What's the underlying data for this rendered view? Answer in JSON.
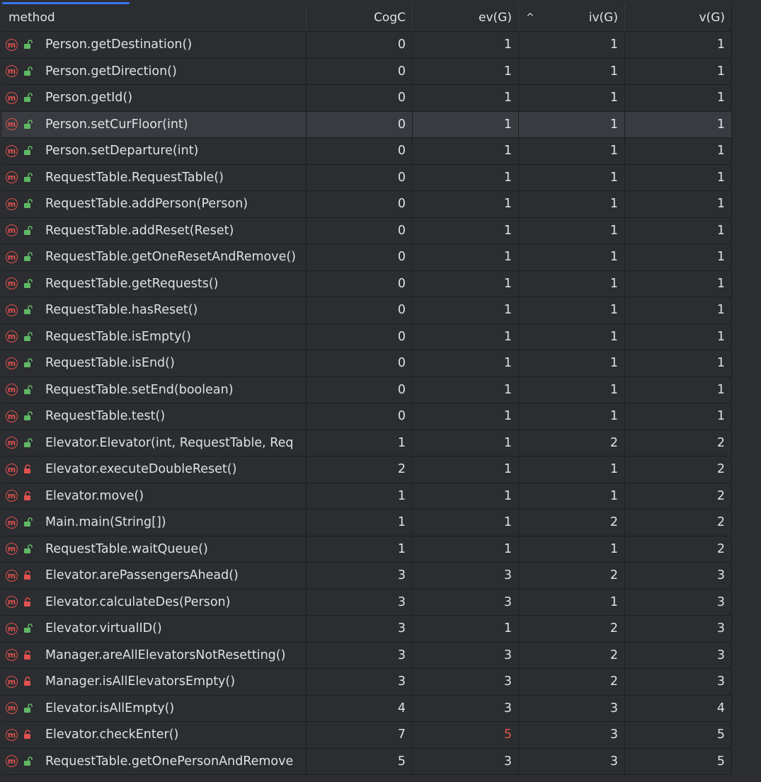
{
  "header": {
    "method": "method",
    "cogc": "CogC",
    "evg": "ev(G)",
    "ivg": "iv(G)",
    "sort_indicator": "^",
    "vg": "v(G)"
  },
  "colors": {
    "method_icon": "#e0524f",
    "public_lock": "#5fb865",
    "private_lock": "#e0524f",
    "warning_value": "#e0524f",
    "progress": "#3574f0"
  },
  "rows": [
    {
      "method": "Person.getDestination()",
      "access": "public",
      "cogc": "0",
      "evg": "1",
      "ivg": "1",
      "vg": "1"
    },
    {
      "method": "Person.getDirection()",
      "access": "public",
      "cogc": "0",
      "evg": "1",
      "ivg": "1",
      "vg": "1"
    },
    {
      "method": "Person.getId()",
      "access": "public",
      "cogc": "0",
      "evg": "1",
      "ivg": "1",
      "vg": "1"
    },
    {
      "method": "Person.setCurFloor(int)",
      "access": "public",
      "cogc": "0",
      "evg": "1",
      "ivg": "1",
      "vg": "1",
      "selected": true
    },
    {
      "method": "Person.setDeparture(int)",
      "access": "public",
      "cogc": "0",
      "evg": "1",
      "ivg": "1",
      "vg": "1"
    },
    {
      "method": "RequestTable.RequestTable()",
      "access": "public",
      "cogc": "0",
      "evg": "1",
      "ivg": "1",
      "vg": "1"
    },
    {
      "method": "RequestTable.addPerson(Person)",
      "access": "public",
      "cogc": "0",
      "evg": "1",
      "ivg": "1",
      "vg": "1"
    },
    {
      "method": "RequestTable.addReset(Reset)",
      "access": "public",
      "cogc": "0",
      "evg": "1",
      "ivg": "1",
      "vg": "1"
    },
    {
      "method": "RequestTable.getOneResetAndRemove()",
      "access": "public",
      "cogc": "0",
      "evg": "1",
      "ivg": "1",
      "vg": "1"
    },
    {
      "method": "RequestTable.getRequests()",
      "access": "public",
      "cogc": "0",
      "evg": "1",
      "ivg": "1",
      "vg": "1"
    },
    {
      "method": "RequestTable.hasReset()",
      "access": "public",
      "cogc": "0",
      "evg": "1",
      "ivg": "1",
      "vg": "1"
    },
    {
      "method": "RequestTable.isEmpty()",
      "access": "public",
      "cogc": "0",
      "evg": "1",
      "ivg": "1",
      "vg": "1"
    },
    {
      "method": "RequestTable.isEnd()",
      "access": "public",
      "cogc": "0",
      "evg": "1",
      "ivg": "1",
      "vg": "1"
    },
    {
      "method": "RequestTable.setEnd(boolean)",
      "access": "public",
      "cogc": "0",
      "evg": "1",
      "ivg": "1",
      "vg": "1"
    },
    {
      "method": "RequestTable.test()",
      "access": "public",
      "cogc": "0",
      "evg": "1",
      "ivg": "1",
      "vg": "1"
    },
    {
      "method": "Elevator.Elevator(int, RequestTable, Req",
      "access": "public",
      "cogc": "1",
      "evg": "1",
      "ivg": "2",
      "vg": "2"
    },
    {
      "method": "Elevator.executeDoubleReset()",
      "access": "private",
      "cogc": "2",
      "evg": "1",
      "ivg": "1",
      "vg": "2"
    },
    {
      "method": "Elevator.move()",
      "access": "private",
      "cogc": "1",
      "evg": "1",
      "ivg": "1",
      "vg": "2"
    },
    {
      "method": "Main.main(String[])",
      "access": "public",
      "cogc": "1",
      "evg": "1",
      "ivg": "2",
      "vg": "2"
    },
    {
      "method": "RequestTable.waitQueue()",
      "access": "public",
      "cogc": "1",
      "evg": "1",
      "ivg": "1",
      "vg": "2"
    },
    {
      "method": "Elevator.arePassengersAhead()",
      "access": "private",
      "cogc": "3",
      "evg": "3",
      "ivg": "2",
      "vg": "3"
    },
    {
      "method": "Elevator.calculateDes(Person)",
      "access": "private",
      "cogc": "3",
      "evg": "3",
      "ivg": "1",
      "vg": "3"
    },
    {
      "method": "Elevator.virtualID()",
      "access": "public",
      "cogc": "3",
      "evg": "1",
      "ivg": "2",
      "vg": "3"
    },
    {
      "method": "Manager.areAllElevatorsNotResetting()",
      "access": "private",
      "cogc": "3",
      "evg": "3",
      "ivg": "2",
      "vg": "3"
    },
    {
      "method": "Manager.isAllElevatorsEmpty()",
      "access": "private",
      "cogc": "3",
      "evg": "3",
      "ivg": "2",
      "vg": "3"
    },
    {
      "method": "Elevator.isAllEmpty()",
      "access": "public",
      "cogc": "4",
      "evg": "3",
      "ivg": "3",
      "vg": "4"
    },
    {
      "method": "Elevator.checkEnter()",
      "access": "private",
      "cogc": "7",
      "evg": "5",
      "ivg": "3",
      "vg": "5",
      "evg_warning": true
    },
    {
      "method": "RequestTable.getOnePersonAndRemove",
      "access": "public",
      "cogc": "5",
      "evg": "3",
      "ivg": "3",
      "vg": "5"
    }
  ]
}
